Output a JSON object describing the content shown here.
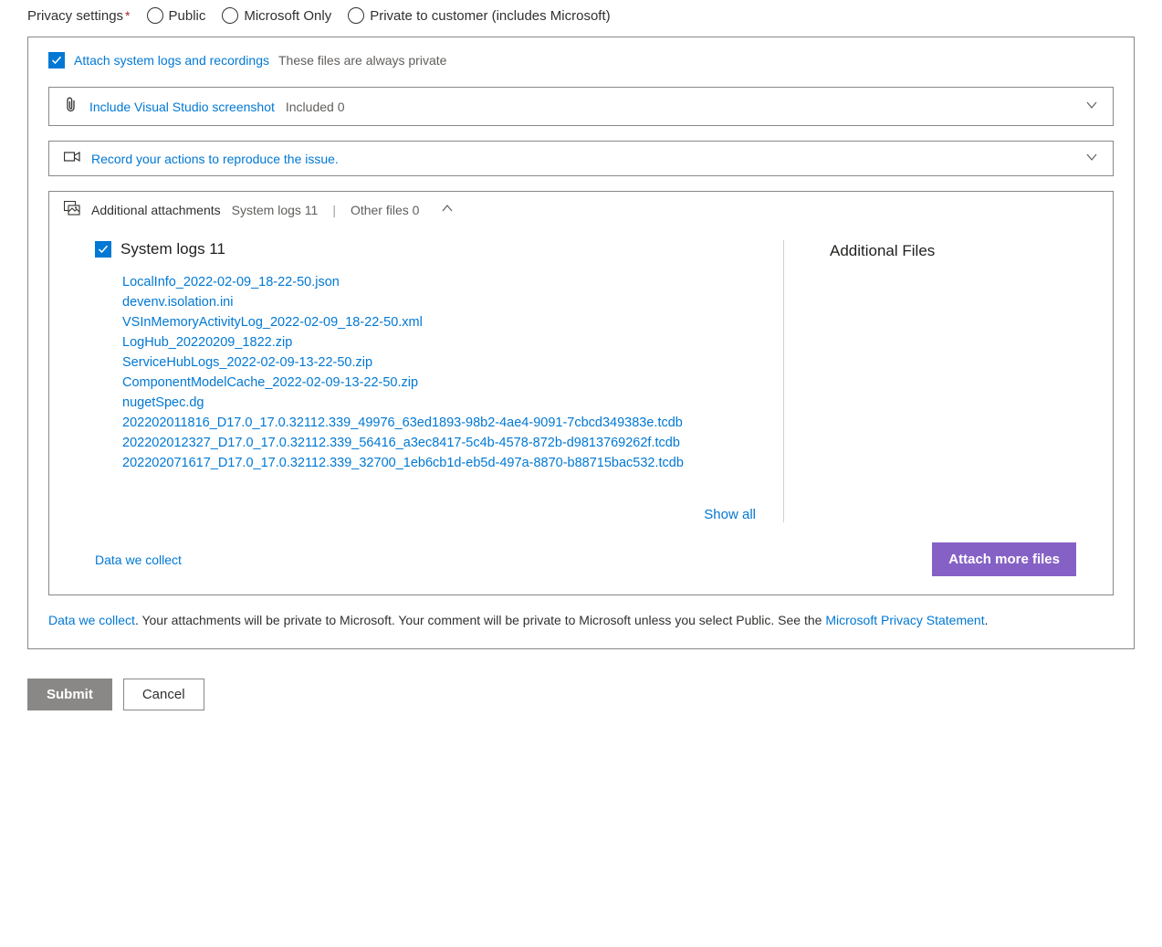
{
  "privacy": {
    "label": "Privacy settings",
    "options": [
      "Public",
      "Microsoft Only",
      "Private to customer (includes Microsoft)"
    ]
  },
  "attach": {
    "checkbox_label": "Attach system logs and recordings",
    "hint": "These files are always private"
  },
  "screenshot_row": {
    "label": "Include Visual Studio screenshot",
    "status": "Included 0"
  },
  "record_row": {
    "label": "Record your actions to reproduce the issue."
  },
  "additional": {
    "header_label": "Additional attachments",
    "syslogs_label": "System logs 11",
    "other_label": "Other files 0"
  },
  "syslogs": {
    "title": "System logs 11",
    "files": [
      "LocalInfo_2022-02-09_18-22-50.json",
      "devenv.isolation.ini",
      "VSInMemoryActivityLog_2022-02-09_18-22-50.xml",
      "LogHub_20220209_1822.zip",
      "ServiceHubLogs_2022-02-09-13-22-50.zip",
      "ComponentModelCache_2022-02-09-13-22-50.zip",
      "nugetSpec.dg",
      "202202011816_D17.0_17.0.32112.339_49976_63ed1893-98b2-4ae4-9091-7cbcd349383e.tcdb",
      "202202012327_D17.0_17.0.32112.339_56416_a3ec8417-5c4b-4578-872b-d9813769262f.tcdb",
      "202202071617_D17.0_17.0.32112.339_32700_1eb6cb1d-eb5d-497a-8870-b88715bac532.tcdb"
    ],
    "show_all": "Show all"
  },
  "right_col": {
    "title": "Additional Files"
  },
  "footer_actions": {
    "data_collect": "Data we collect",
    "attach_more": "Attach more files"
  },
  "privacy_footer": {
    "link1": "Data we collect",
    "text1": ". Your attachments will be private to Microsoft. Your comment will be private to Microsoft unless you select Public. See the ",
    "link2": "Microsoft Privacy Statement",
    "text2": "."
  },
  "buttons": {
    "submit": "Submit",
    "cancel": "Cancel"
  }
}
